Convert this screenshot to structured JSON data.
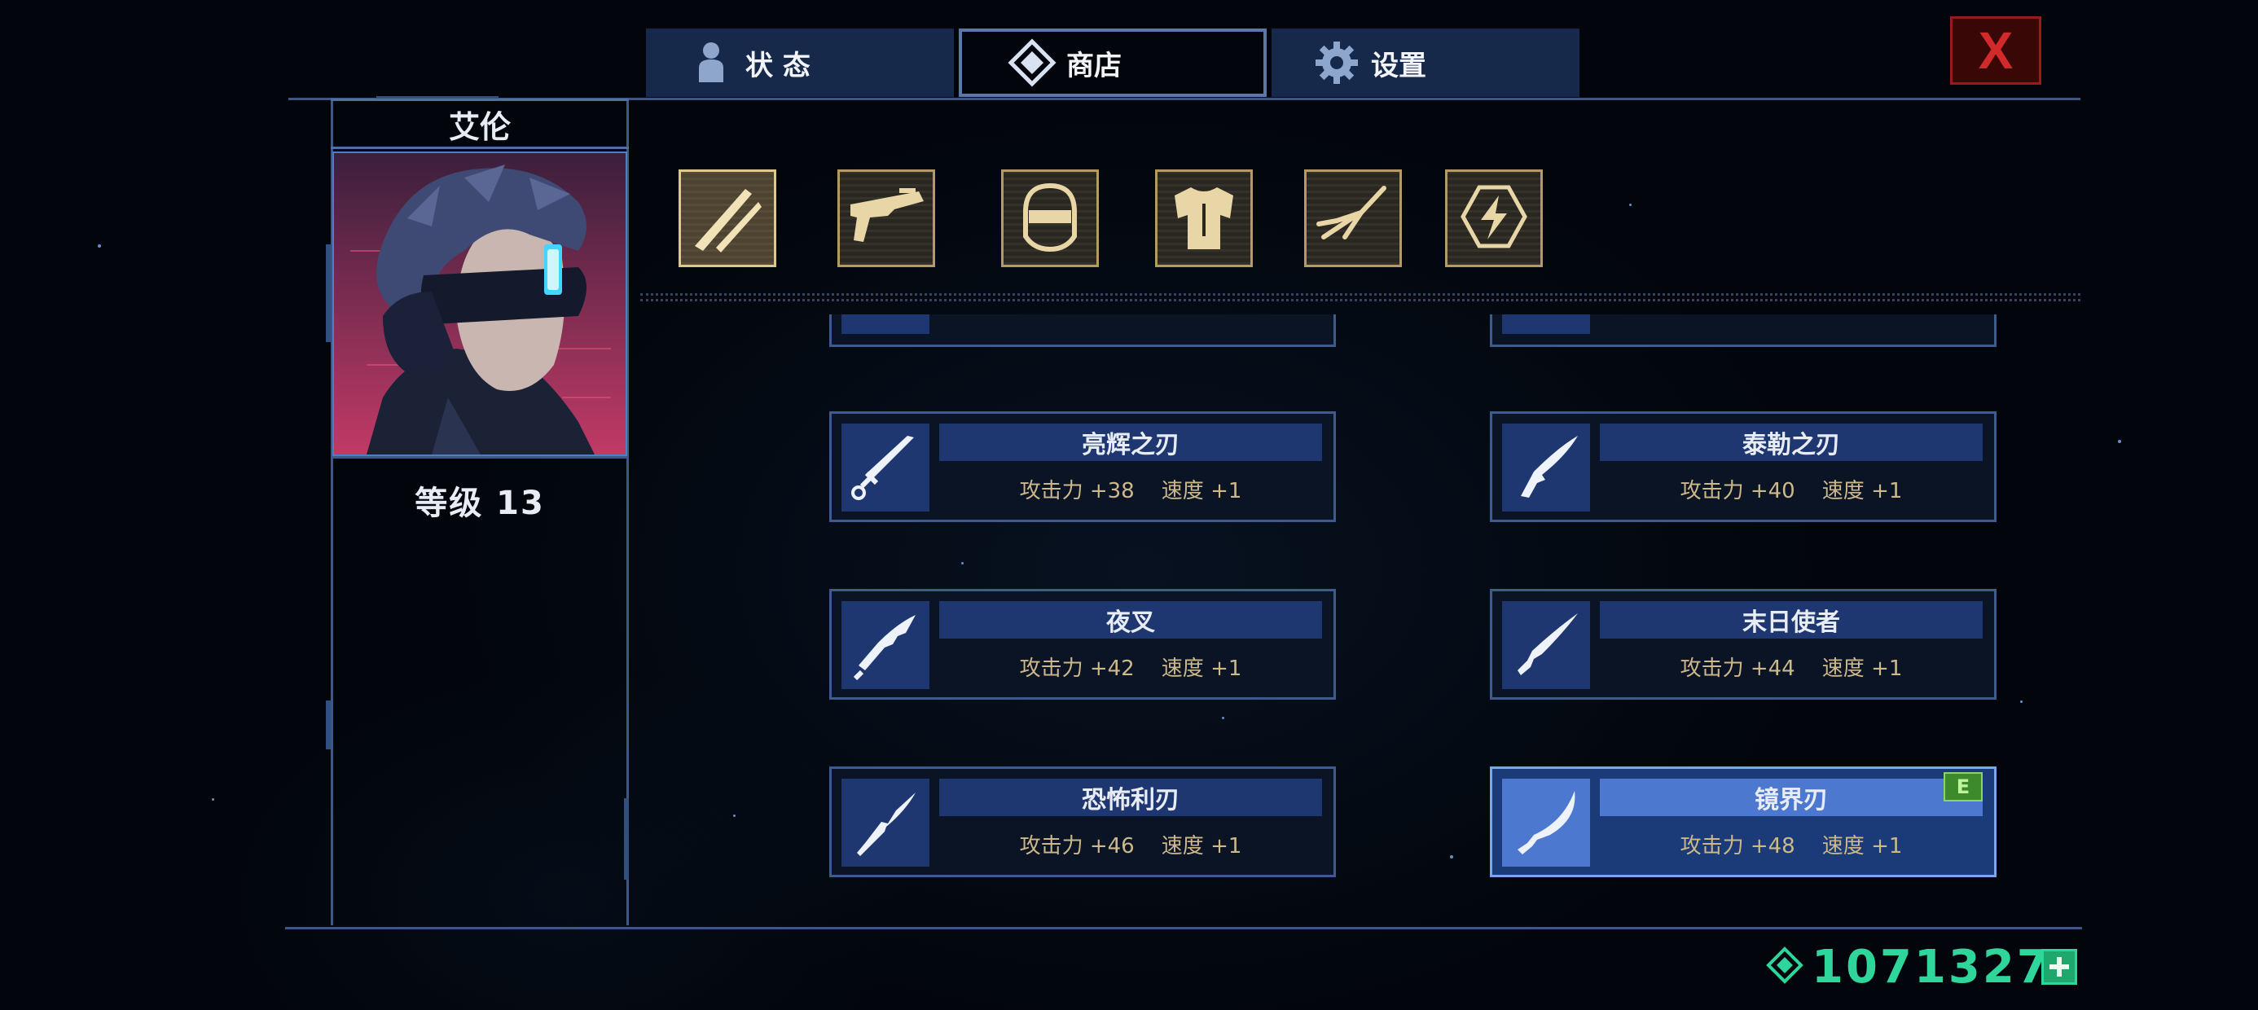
{
  "tabs": [
    {
      "label": "状 态",
      "icon": "person-icon",
      "active": false
    },
    {
      "label": "商店",
      "icon": "diamond-icon",
      "active": true
    },
    {
      "label": "设置",
      "icon": "gear-icon",
      "active": false
    }
  ],
  "close_label": "X",
  "character": {
    "name": "艾伦",
    "level_text": "等级 13"
  },
  "categories": [
    {
      "icon": "blades-icon",
      "active": true
    },
    {
      "icon": "gun-icon",
      "active": false
    },
    {
      "icon": "helmet-icon",
      "active": false
    },
    {
      "icon": "armor-icon",
      "active": false
    },
    {
      "icon": "claw-icon",
      "active": false
    },
    {
      "icon": "energy-icon",
      "active": false
    }
  ],
  "items": [
    {
      "name": "亮辉之刃",
      "attack_label": "攻击力",
      "attack": "+38",
      "speed_label": "速度",
      "speed": "+1",
      "selected": false,
      "equipped": false
    },
    {
      "name": "泰勒之刃",
      "attack_label": "攻击力",
      "attack": "+40",
      "speed_label": "速度",
      "speed": "+1",
      "selected": false,
      "equipped": false
    },
    {
      "name": "夜叉",
      "attack_label": "攻击力",
      "attack": "+42",
      "speed_label": "速度",
      "speed": "+1",
      "selected": false,
      "equipped": false
    },
    {
      "name": "末日使者",
      "attack_label": "攻击力",
      "attack": "+44",
      "speed_label": "速度",
      "speed": "+1",
      "selected": false,
      "equipped": false
    },
    {
      "name": "恐怖利刃",
      "attack_label": "攻击力",
      "attack": "+46",
      "speed_label": "速度",
      "speed": "+1",
      "selected": false,
      "equipped": false
    },
    {
      "name": "镜界刃",
      "attack_label": "攻击力",
      "attack": "+48",
      "speed_label": "速度",
      "speed": "+1",
      "selected": true,
      "equipped": true
    }
  ],
  "equipped_badge": "E",
  "currency": {
    "icon": "gem-icon",
    "amount": "1071327"
  },
  "colors": {
    "accent": "#4d78cf",
    "currency": "#2fd69c",
    "close": "#9a1a1a",
    "gold": "#cdb88a"
  }
}
